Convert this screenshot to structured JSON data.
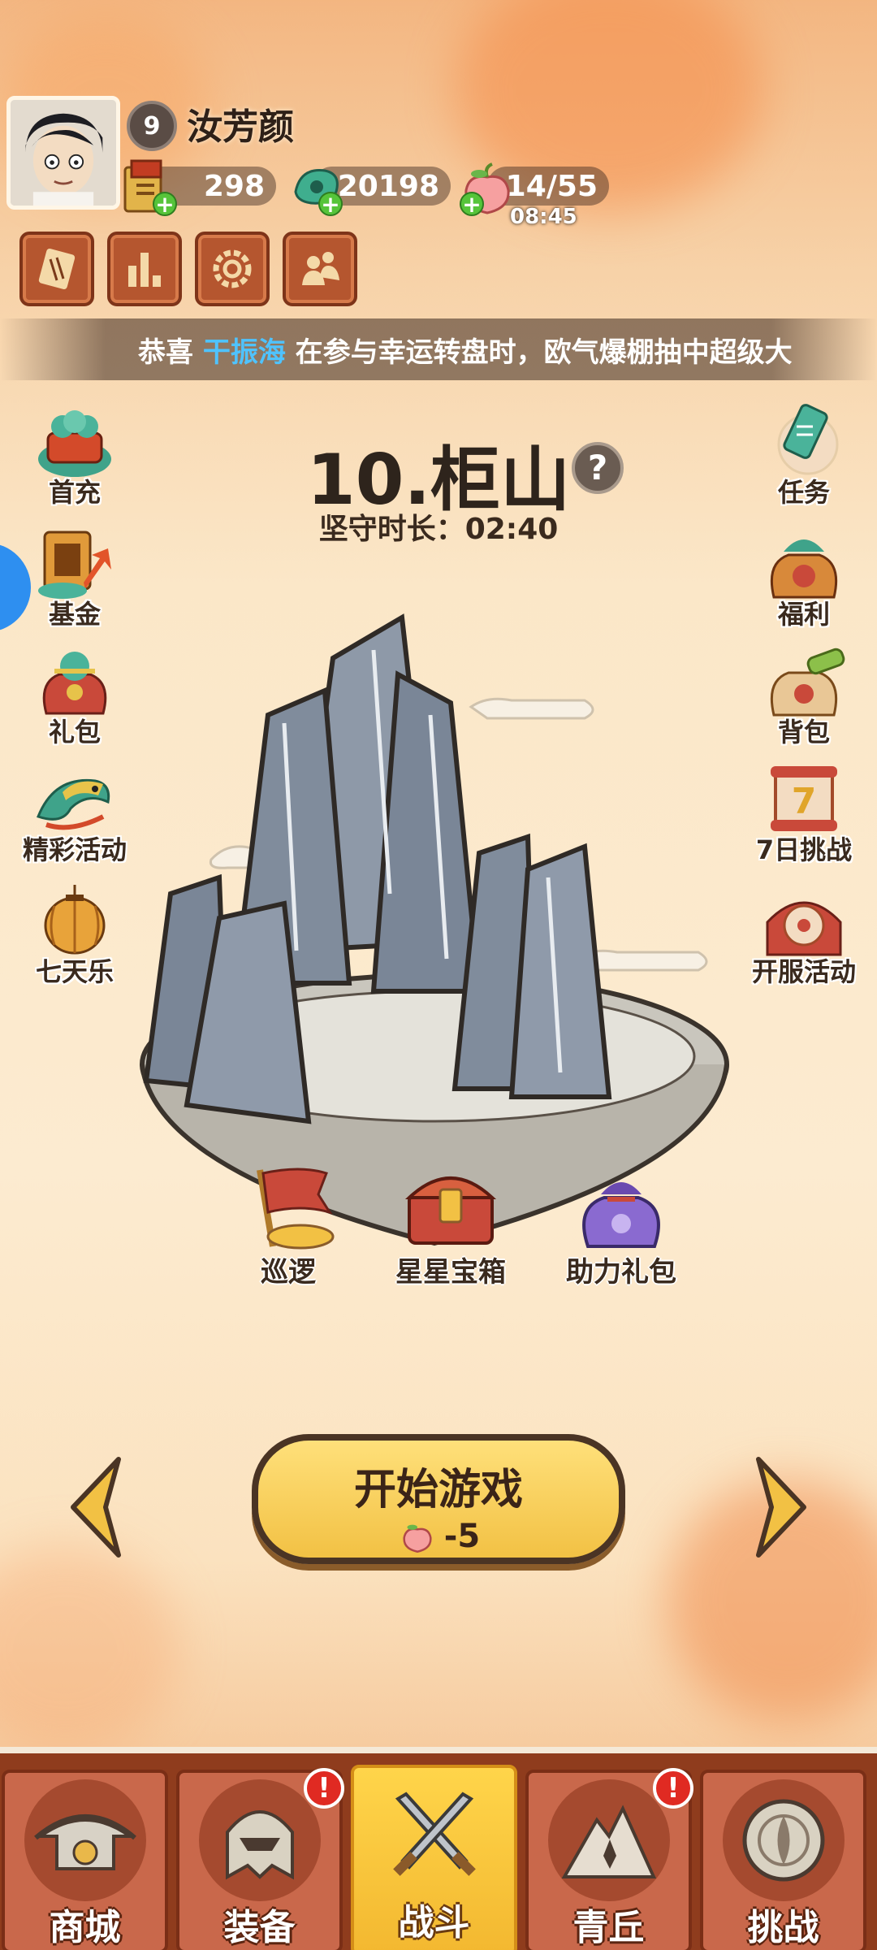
{
  "player": {
    "level": "9",
    "name": "汝芳颜"
  },
  "resources": {
    "tickets": "298",
    "jade": "20198",
    "stamina": "14/55",
    "stamina_timer": "08:45"
  },
  "ticker": {
    "prefix": "恭喜 ",
    "highlight": "干振海",
    "suffix": " 在参与幸运转盘时，欧气爆棚抽中超级大"
  },
  "left_menu": [
    "首充",
    "基金",
    "礼包",
    "精彩活动",
    "七天乐"
  ],
  "right_menu": [
    "任务",
    "福利",
    "背包",
    "7日挑战",
    "开服活动"
  ],
  "stage": {
    "title": "10.柜山",
    "help_icon": "question-icon",
    "hold_label": "坚守时长：",
    "hold_time": "02:40"
  },
  "chests": [
    "巡逻",
    "星星宝箱",
    "助力礼包"
  ],
  "start": {
    "label": "开始游戏",
    "cost": "-5"
  },
  "bottom_nav": [
    {
      "label": "商城",
      "alert": ""
    },
    {
      "label": "装备",
      "alert": "!"
    },
    {
      "label": "战斗",
      "alert": ""
    },
    {
      "label": "青丘",
      "alert": "!"
    },
    {
      "label": "挑战",
      "alert": ""
    }
  ],
  "colors": {
    "accent": "#f2c144",
    "nav_bg": "#8f3c1d",
    "ticker_highlight": "#4fc3ff"
  }
}
